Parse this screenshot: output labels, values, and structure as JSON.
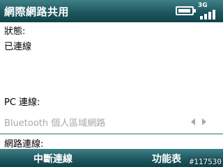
{
  "window": {
    "title": "網際網路共用"
  },
  "status_bar": {
    "network_type": "3G",
    "battery_icon": "battery-icon",
    "signal_icon": "signal-strength-icon"
  },
  "connection": {
    "status_label": "狀態:",
    "status_value": "已連線",
    "pc_connection_label": "PC 連線:",
    "pc_connection_value": "Bluetooth 個人區域網路",
    "network_connection_label": "網路連線:"
  },
  "softkeys": {
    "left": "中斷連線",
    "right": "功能表"
  },
  "watermark": "#117530"
}
